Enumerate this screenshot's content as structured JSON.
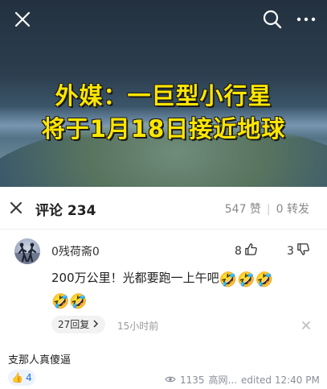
{
  "video": {
    "headline_line1": "外媒：一巨型小行星",
    "headline_line2": "将于1月18日接近地球"
  },
  "panel": {
    "title": "评论 234",
    "likes_count": "547 赞",
    "shares_count": "0 转发"
  },
  "comment": {
    "username": "0残荷斋0",
    "likes": "8",
    "dislikes": "3",
    "text": "200万公里！光都要跑一上午吧",
    "emojis": [
      "🤣",
      "🤣",
      "🤣",
      "🤣",
      "🤣"
    ],
    "replies": "27回复",
    "time": "15小时前"
  },
  "bottom": {
    "text": "支那人真傻逼",
    "reaction_emoji": "👍",
    "reaction_count": "4",
    "views": "1135",
    "author": "高网...",
    "edited": "edited 12:40 PM"
  },
  "icons": {
    "top_close": "close-icon",
    "top_search": "search-icon",
    "top_more": "more-icon",
    "panel_close": "close-icon",
    "thumb_up": "thumb-up-icon",
    "thumb_down": "thumb-down-icon",
    "reply_chevron": "chevron-right-icon",
    "delete": "close-icon",
    "views": "eye-icon"
  }
}
